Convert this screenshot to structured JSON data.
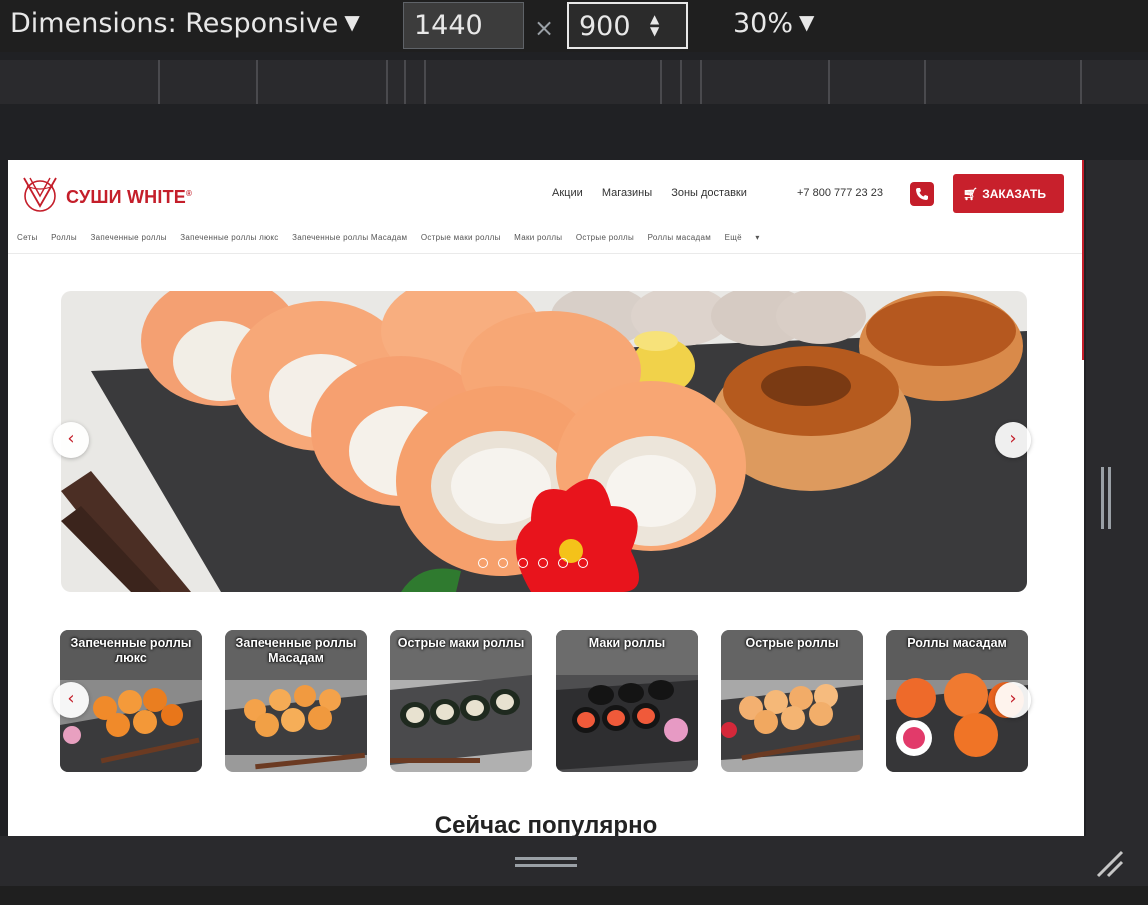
{
  "devtools": {
    "dimensions_label": "Dimensions: Responsive",
    "width_value": "1440",
    "times": "×",
    "height_value": "900",
    "zoom_label": "30%"
  },
  "site": {
    "brand": "СУШИ WHITE",
    "brand_mark": "®",
    "top_nav": [
      "Акции",
      "Магазины",
      "Зоны доставки"
    ],
    "phone": "+7 800 777 23 23",
    "order_button": "ЗАКАЗАТЬ",
    "categories": [
      "Сеты",
      "Роллы",
      "Запеченные роллы",
      "Запеченные роллы люкс",
      "Запеченные роллы Масадам",
      "Острые маки роллы",
      "Маки роллы",
      "Острые роллы",
      "Роллы масадам",
      "Ещё"
    ],
    "carousel_dots": 6,
    "cards": [
      {
        "title": "Запеченные роллы люкс"
      },
      {
        "title": "Запеченные роллы Масадам"
      },
      {
        "title": "Острые маки роллы"
      },
      {
        "title": "Маки роллы"
      },
      {
        "title": "Острые роллы"
      },
      {
        "title": "Роллы масадам"
      }
    ],
    "section_title": "Сейчас популярно"
  },
  "colors": {
    "brand_red": "#c41e2a",
    "devtools_bg": "#202124"
  }
}
